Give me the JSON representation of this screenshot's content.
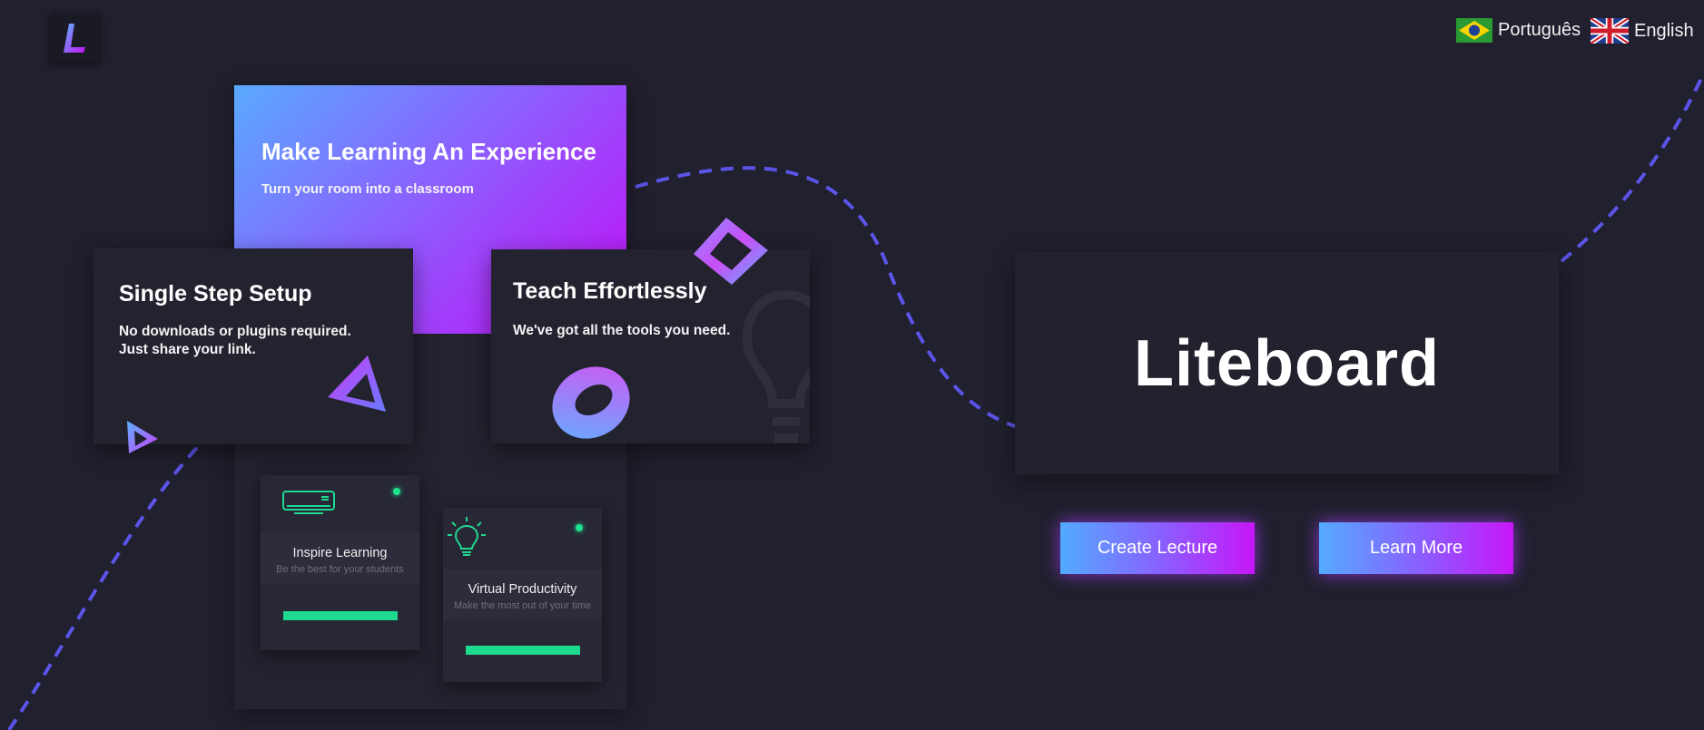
{
  "app": {
    "name": "Liteboard"
  },
  "header": {
    "languages": [
      {
        "label": "Português",
        "flag": "flag-brazil-icon"
      },
      {
        "label": "English",
        "flag": "flag-uk-icon"
      }
    ]
  },
  "hero": {
    "title": "Make Learning An Experience",
    "subtitle": "Turn your room into a classroom"
  },
  "cards": {
    "setup": {
      "title": "Single Step Setup",
      "line1": "No downloads or plugins required.",
      "line2": "Just share your link."
    },
    "teach": {
      "title": "Teach Effortlessly",
      "text": "We've got all the tools you need."
    }
  },
  "minis": [
    {
      "name": "Inspire Learning",
      "desc": "Be the best for your students",
      "icon": "air-conditioner-icon"
    },
    {
      "name": "Virtual Productivity",
      "desc": "Make the most out of your time",
      "icon": "lightbulb-icon"
    }
  ],
  "actions": {
    "create": "Create Lecture",
    "learn": "Learn More"
  },
  "colors": {
    "background": "#20202e",
    "accent_start": "#53abff",
    "accent_end": "#c716f7",
    "status_green": "#1fe08e",
    "dash": "#5b54e8"
  }
}
